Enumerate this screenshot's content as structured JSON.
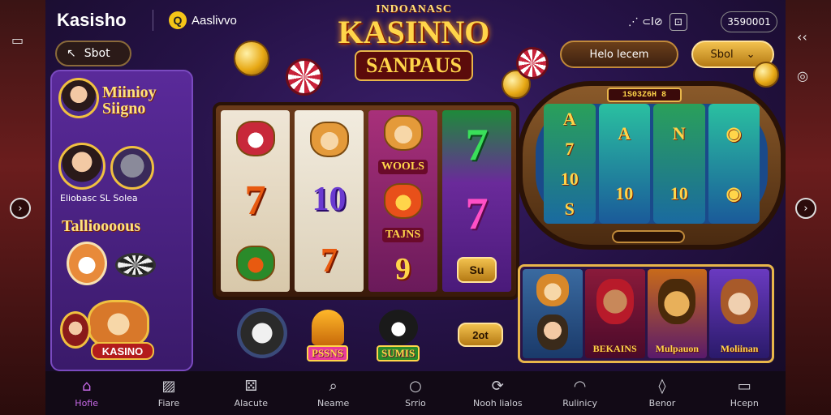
{
  "header": {
    "brand": "Kasisho",
    "sub_brand": "Aaslivvo",
    "sub_brand_icon": "q-logo-icon",
    "status": {
      "signal_text": "⋰ ⊂I⊘",
      "battery_badge": "⊡"
    },
    "balance": "3590001"
  },
  "back_button": {
    "label": "Sbot",
    "icon": "arrow-back-icon"
  },
  "logo": {
    "top_line": "INDOANASC",
    "main": "KASINNO",
    "sub": "SANPAUS"
  },
  "buttons": {
    "refer": "Helo lecem",
    "sort": "Sbol",
    "sort_chevron": "⌄",
    "spin": "Su",
    "mini_sort": "2ot"
  },
  "left_panel": {
    "title_line1": "Miinioy",
    "title_line2": "Siigno",
    "caption": "Eliobasc SL Solea",
    "tag_title": "Tallioooous",
    "kasino_label": "KASINO"
  },
  "slot_machine": {
    "reel1": [
      "7",
      "⌖"
    ],
    "reel2": [
      "10",
      "7"
    ],
    "reel3_labels": [
      "WOOLS",
      "TAJNS"
    ],
    "reel3_symbol": "9",
    "reel4": [
      "7",
      "7"
    ]
  },
  "oval_machine": {
    "jackpot": "1S03Z6H 8",
    "reel_a": [
      "A",
      "7",
      "10",
      "S"
    ],
    "reel_b": [
      "A",
      "10"
    ],
    "reel_c": [
      "N",
      "10"
    ]
  },
  "game_row": [
    {
      "label": ""
    },
    {
      "label": "PSSNS"
    },
    {
      "label": "SUMIS"
    }
  ],
  "character_cards": [
    {
      "name": ""
    },
    {
      "name": "BEKAINS"
    },
    {
      "name": "Mulpauon"
    },
    {
      "name": "Moliinan"
    }
  ],
  "bottom_nav": [
    {
      "label": "Hofie",
      "icon": "home-icon",
      "glyph": "⌂"
    },
    {
      "label": "Fiare",
      "icon": "image-icon",
      "glyph": "▨"
    },
    {
      "label": "Alacute",
      "icon": "dice-icon",
      "glyph": "⚄"
    },
    {
      "label": "Neame",
      "icon": "search-icon",
      "glyph": "⌕"
    },
    {
      "label": "Srrio",
      "icon": "search-circle-icon",
      "glyph": "○"
    },
    {
      "label": "Nooh lialos",
      "icon": "refresh-icon",
      "glyph": "⟳"
    },
    {
      "label": "Rulinicy",
      "icon": "smile-icon",
      "glyph": "◠"
    },
    {
      "label": "Benor",
      "icon": "drop-icon",
      "glyph": "◊"
    },
    {
      "label": "Hcepn",
      "icon": "chat-icon",
      "glyph": "▭"
    }
  ],
  "colors": {
    "accent_gold": "#f2c14e",
    "panel_purple": "#5a2a9a",
    "active_nav": "#c86ae8"
  }
}
